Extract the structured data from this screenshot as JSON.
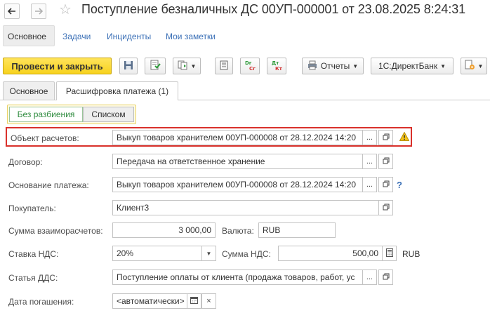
{
  "window": {
    "title": "Поступление безналичных ДС 00УП-000001 от 23.08.2025 8:24:31"
  },
  "sections": [
    {
      "label": "Основное"
    },
    {
      "label": "Задачи"
    },
    {
      "label": "Инциденты"
    },
    {
      "label": "Мои заметки"
    }
  ],
  "toolbar": {
    "post_close_label": "Провести и закрыть",
    "reports_label": "Отчеты",
    "directbank_label": "1С:ДиректБанк"
  },
  "tabs": [
    {
      "label": "Основное"
    },
    {
      "label": "Расшифровка платежа (1)"
    }
  ],
  "view_toggle": {
    "no_split_label": "Без разбиения",
    "list_label": "Списком"
  },
  "form": {
    "settlement_object": {
      "label": "Объект расчетов:",
      "value": "Выкуп товаров хранителем 00УП-000008 от 28.12.2024 14:20"
    },
    "contract": {
      "label": "Договор:",
      "value": "Передача на ответственное хранение"
    },
    "payment_basis": {
      "label": "Основание платежа:",
      "value": "Выкуп товаров хранителем 00УП-000008 от 28.12.2024 14:20"
    },
    "buyer": {
      "label": "Покупатель:",
      "value": "Клиент3"
    },
    "settlement_amount": {
      "label": "Сумма взаиморасчетов:",
      "value": "3 000,00"
    },
    "currency": {
      "label": "Валюта:",
      "value": "RUB"
    },
    "vat_rate": {
      "label": "Ставка НДС:",
      "value": "20%"
    },
    "vat_amount": {
      "label": "Сумма НДС:",
      "value": "500,00",
      "currency": "RUB"
    },
    "cash_flow_item": {
      "label": "Статья ДДС:",
      "value": "Поступление оплаты от клиента (продажа товаров, работ, ус"
    },
    "due_date": {
      "label": "Дата погашения:",
      "value": "<автоматически>"
    }
  },
  "glyphs": {
    "ellipsis": "...",
    "question": "?",
    "clear": "×",
    "back": "🡐",
    "forward": "🡒"
  },
  "colors": {
    "accent_yellow": "#f7d21e",
    "link_blue": "#3a6fb6",
    "highlight_red": "#d9312b",
    "toggle_green": "#2e8b3e"
  },
  "icons": {
    "back": "arrow-left-icon",
    "forward": "arrow-right-icon",
    "favorite": "star-icon",
    "save": "floppy-icon",
    "warning": "warning-triangle-icon"
  }
}
